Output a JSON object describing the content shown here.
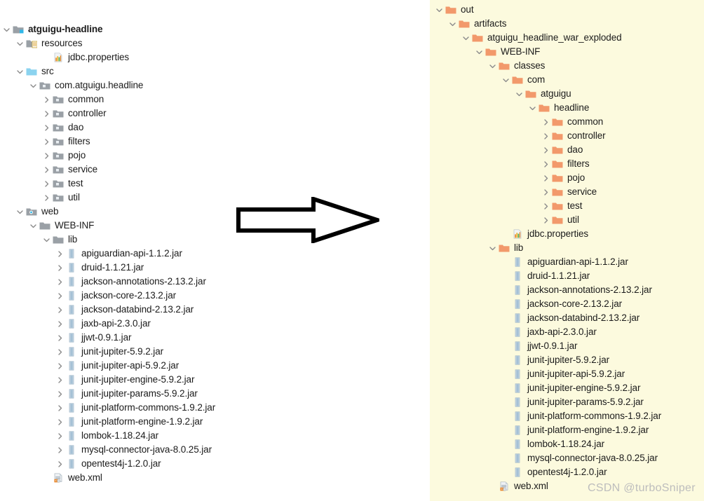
{
  "watermark": "CSDN @turboSniper",
  "arrow": {
    "name": "right-arrow",
    "direction": "right",
    "color": "#000000"
  },
  "colors": {
    "left_panel_bg": "#ffffff",
    "right_panel_bg": "#fcfade",
    "folder_orange": "#f2996b",
    "folder_grey": "#9aa0a6",
    "folder_blue": "#8bd3ef",
    "jar_icon": "#a8c4d8",
    "text": "#1b1b1b",
    "chevron": "#8a8a8a",
    "watermark": "#bdbdbd"
  },
  "left_tree": {
    "title": "project-source-tree",
    "nodes": [
      {
        "depth": 0,
        "label": "atguigu-headline",
        "icon": "module-icon",
        "toggle": "expanded",
        "bold": true
      },
      {
        "depth": 1,
        "label": "resources",
        "icon": "resources-folder-icon",
        "toggle": "expanded",
        "bold": false
      },
      {
        "depth": 3,
        "label": "jdbc.properties",
        "icon": "properties-file-icon",
        "toggle": "none",
        "bold": false
      },
      {
        "depth": 1,
        "label": "src",
        "icon": "source-folder-icon",
        "toggle": "expanded",
        "bold": false
      },
      {
        "depth": 2,
        "label": "com.atguigu.headline",
        "icon": "package-icon",
        "toggle": "expanded",
        "bold": false
      },
      {
        "depth": 3,
        "label": "common",
        "icon": "package-icon",
        "toggle": "collapsed",
        "bold": false
      },
      {
        "depth": 3,
        "label": "controller",
        "icon": "package-icon",
        "toggle": "collapsed",
        "bold": false
      },
      {
        "depth": 3,
        "label": "dao",
        "icon": "package-icon",
        "toggle": "collapsed",
        "bold": false
      },
      {
        "depth": 3,
        "label": "filters",
        "icon": "package-icon",
        "toggle": "collapsed",
        "bold": false
      },
      {
        "depth": 3,
        "label": "pojo",
        "icon": "package-icon",
        "toggle": "collapsed",
        "bold": false
      },
      {
        "depth": 3,
        "label": "service",
        "icon": "package-icon",
        "toggle": "collapsed",
        "bold": false
      },
      {
        "depth": 3,
        "label": "test",
        "icon": "package-icon",
        "toggle": "collapsed",
        "bold": false
      },
      {
        "depth": 3,
        "label": "util",
        "icon": "package-icon",
        "toggle": "collapsed",
        "bold": false
      },
      {
        "depth": 1,
        "label": "web",
        "icon": "web-folder-icon",
        "toggle": "expanded",
        "bold": false
      },
      {
        "depth": 2,
        "label": "WEB-INF",
        "icon": "folder-grey-icon",
        "toggle": "expanded",
        "bold": false
      },
      {
        "depth": 3,
        "label": "lib",
        "icon": "folder-grey-icon",
        "toggle": "expanded",
        "bold": false
      },
      {
        "depth": 4,
        "label": "apiguardian-api-1.1.2.jar",
        "icon": "jar-icon",
        "toggle": "collapsed",
        "bold": false
      },
      {
        "depth": 4,
        "label": "druid-1.1.21.jar",
        "icon": "jar-icon",
        "toggle": "collapsed",
        "bold": false
      },
      {
        "depth": 4,
        "label": "jackson-annotations-2.13.2.jar",
        "icon": "jar-icon",
        "toggle": "collapsed",
        "bold": false
      },
      {
        "depth": 4,
        "label": "jackson-core-2.13.2.jar",
        "icon": "jar-icon",
        "toggle": "collapsed",
        "bold": false
      },
      {
        "depth": 4,
        "label": "jackson-databind-2.13.2.jar",
        "icon": "jar-icon",
        "toggle": "collapsed",
        "bold": false
      },
      {
        "depth": 4,
        "label": "jaxb-api-2.3.0.jar",
        "icon": "jar-icon",
        "toggle": "collapsed",
        "bold": false
      },
      {
        "depth": 4,
        "label": "jjwt-0.9.1.jar",
        "icon": "jar-icon",
        "toggle": "collapsed",
        "bold": false
      },
      {
        "depth": 4,
        "label": "junit-jupiter-5.9.2.jar",
        "icon": "jar-icon",
        "toggle": "collapsed",
        "bold": false
      },
      {
        "depth": 4,
        "label": "junit-jupiter-api-5.9.2.jar",
        "icon": "jar-icon",
        "toggle": "collapsed",
        "bold": false
      },
      {
        "depth": 4,
        "label": "junit-jupiter-engine-5.9.2.jar",
        "icon": "jar-icon",
        "toggle": "collapsed",
        "bold": false
      },
      {
        "depth": 4,
        "label": "junit-jupiter-params-5.9.2.jar",
        "icon": "jar-icon",
        "toggle": "collapsed",
        "bold": false
      },
      {
        "depth": 4,
        "label": "junit-platform-commons-1.9.2.jar",
        "icon": "jar-icon",
        "toggle": "collapsed",
        "bold": false
      },
      {
        "depth": 4,
        "label": "junit-platform-engine-1.9.2.jar",
        "icon": "jar-icon",
        "toggle": "collapsed",
        "bold": false
      },
      {
        "depth": 4,
        "label": "lombok-1.18.24.jar",
        "icon": "jar-icon",
        "toggle": "collapsed",
        "bold": false
      },
      {
        "depth": 4,
        "label": "mysql-connector-java-8.0.25.jar",
        "icon": "jar-icon",
        "toggle": "collapsed",
        "bold": false
      },
      {
        "depth": 4,
        "label": "opentest4j-1.2.0.jar",
        "icon": "jar-icon",
        "toggle": "collapsed",
        "bold": false
      },
      {
        "depth": 3,
        "label": "web.xml",
        "icon": "xml-file-icon",
        "toggle": "none",
        "bold": false
      }
    ]
  },
  "right_tree": {
    "title": "artifact-output-tree",
    "nodes": [
      {
        "depth": 0,
        "label": "out",
        "icon": "folder-orange-icon",
        "toggle": "expanded",
        "bold": false
      },
      {
        "depth": 1,
        "label": "artifacts",
        "icon": "folder-orange-icon",
        "toggle": "expanded",
        "bold": false
      },
      {
        "depth": 2,
        "label": "atguigu_headline_war_exploded",
        "icon": "folder-orange-icon",
        "toggle": "expanded",
        "bold": false
      },
      {
        "depth": 3,
        "label": "WEB-INF",
        "icon": "folder-orange-icon",
        "toggle": "expanded",
        "bold": false
      },
      {
        "depth": 4,
        "label": "classes",
        "icon": "folder-orange-icon",
        "toggle": "expanded",
        "bold": false
      },
      {
        "depth": 5,
        "label": "com",
        "icon": "folder-orange-icon",
        "toggle": "expanded",
        "bold": false
      },
      {
        "depth": 6,
        "label": "atguigu",
        "icon": "folder-orange-icon",
        "toggle": "expanded",
        "bold": false
      },
      {
        "depth": 7,
        "label": "headline",
        "icon": "folder-orange-icon",
        "toggle": "expanded",
        "bold": false
      },
      {
        "depth": 8,
        "label": "common",
        "icon": "folder-orange-icon",
        "toggle": "collapsed",
        "bold": false
      },
      {
        "depth": 8,
        "label": "controller",
        "icon": "folder-orange-icon",
        "toggle": "collapsed",
        "bold": false
      },
      {
        "depth": 8,
        "label": "dao",
        "icon": "folder-orange-icon",
        "toggle": "collapsed",
        "bold": false
      },
      {
        "depth": 8,
        "label": "filters",
        "icon": "folder-orange-icon",
        "toggle": "collapsed",
        "bold": false
      },
      {
        "depth": 8,
        "label": "pojo",
        "icon": "folder-orange-icon",
        "toggle": "collapsed",
        "bold": false
      },
      {
        "depth": 8,
        "label": "service",
        "icon": "folder-orange-icon",
        "toggle": "collapsed",
        "bold": false
      },
      {
        "depth": 8,
        "label": "test",
        "icon": "folder-orange-icon",
        "toggle": "collapsed",
        "bold": false
      },
      {
        "depth": 8,
        "label": "util",
        "icon": "folder-orange-icon",
        "toggle": "collapsed",
        "bold": false
      },
      {
        "depth": 5,
        "label": "jdbc.properties",
        "icon": "properties-file-icon",
        "toggle": "none",
        "bold": false
      },
      {
        "depth": 4,
        "label": "lib",
        "icon": "folder-orange-icon",
        "toggle": "expanded",
        "bold": false
      },
      {
        "depth": 5,
        "label": "apiguardian-api-1.1.2.jar",
        "icon": "jar-icon",
        "toggle": "none",
        "bold": false
      },
      {
        "depth": 5,
        "label": "druid-1.1.21.jar",
        "icon": "jar-icon",
        "toggle": "none",
        "bold": false
      },
      {
        "depth": 5,
        "label": "jackson-annotations-2.13.2.jar",
        "icon": "jar-icon",
        "toggle": "none",
        "bold": false
      },
      {
        "depth": 5,
        "label": "jackson-core-2.13.2.jar",
        "icon": "jar-icon",
        "toggle": "none",
        "bold": false
      },
      {
        "depth": 5,
        "label": "jackson-databind-2.13.2.jar",
        "icon": "jar-icon",
        "toggle": "none",
        "bold": false
      },
      {
        "depth": 5,
        "label": "jaxb-api-2.3.0.jar",
        "icon": "jar-icon",
        "toggle": "none",
        "bold": false
      },
      {
        "depth": 5,
        "label": "jjwt-0.9.1.jar",
        "icon": "jar-icon",
        "toggle": "none",
        "bold": false
      },
      {
        "depth": 5,
        "label": "junit-jupiter-5.9.2.jar",
        "icon": "jar-icon",
        "toggle": "none",
        "bold": false
      },
      {
        "depth": 5,
        "label": "junit-jupiter-api-5.9.2.jar",
        "icon": "jar-icon",
        "toggle": "none",
        "bold": false
      },
      {
        "depth": 5,
        "label": "junit-jupiter-engine-5.9.2.jar",
        "icon": "jar-icon",
        "toggle": "none",
        "bold": false
      },
      {
        "depth": 5,
        "label": "junit-jupiter-params-5.9.2.jar",
        "icon": "jar-icon",
        "toggle": "none",
        "bold": false
      },
      {
        "depth": 5,
        "label": "junit-platform-commons-1.9.2.jar",
        "icon": "jar-icon",
        "toggle": "none",
        "bold": false
      },
      {
        "depth": 5,
        "label": "junit-platform-engine-1.9.2.jar",
        "icon": "jar-icon",
        "toggle": "none",
        "bold": false
      },
      {
        "depth": 5,
        "label": "lombok-1.18.24.jar",
        "icon": "jar-icon",
        "toggle": "none",
        "bold": false
      },
      {
        "depth": 5,
        "label": "mysql-connector-java-8.0.25.jar",
        "icon": "jar-icon",
        "toggle": "none",
        "bold": false
      },
      {
        "depth": 5,
        "label": "opentest4j-1.2.0.jar",
        "icon": "jar-icon",
        "toggle": "none",
        "bold": false
      },
      {
        "depth": 4,
        "label": "web.xml",
        "icon": "xml-file-icon",
        "toggle": "none",
        "bold": false
      }
    ]
  }
}
